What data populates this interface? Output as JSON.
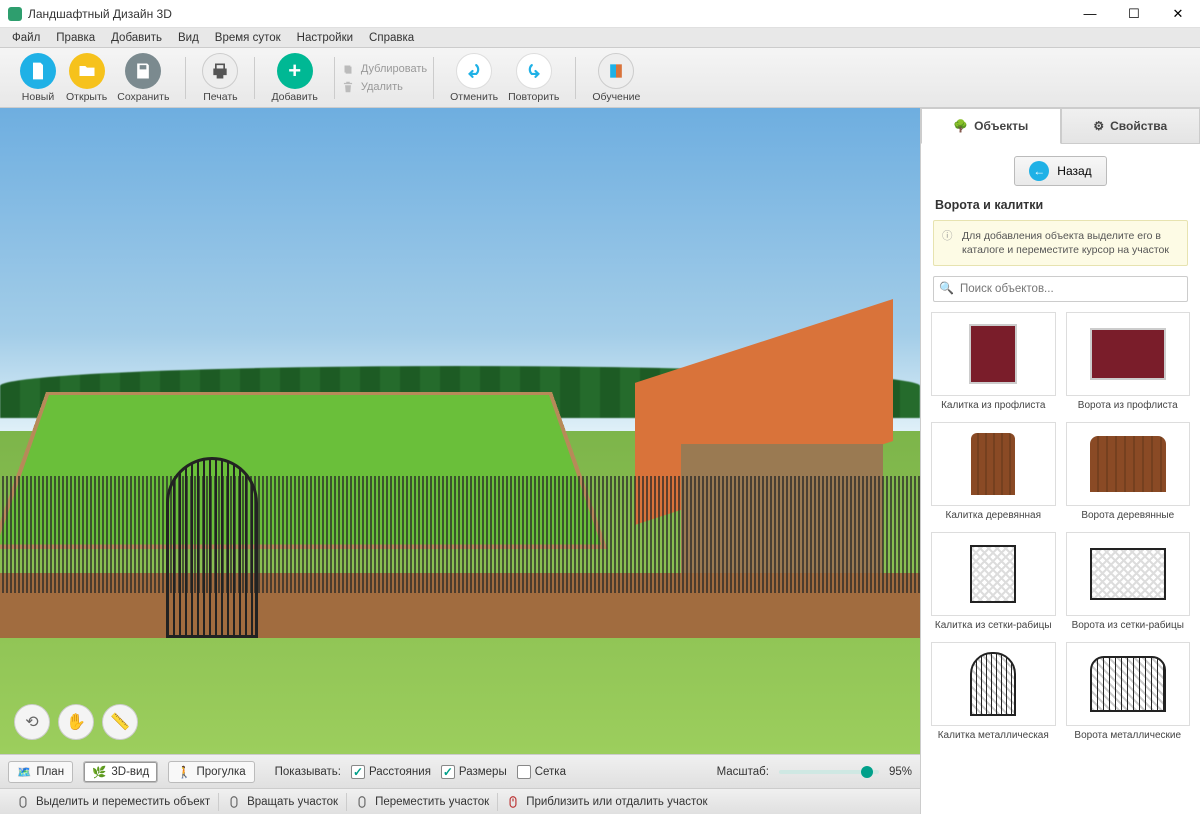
{
  "window": {
    "title": "Ландшафтный Дизайн 3D"
  },
  "menu": [
    "Файл",
    "Правка",
    "Добавить",
    "Вид",
    "Время суток",
    "Настройки",
    "Справка"
  ],
  "toolbar": {
    "new": "Новый",
    "open": "Открыть",
    "save": "Сохранить",
    "print": "Печать",
    "add": "Добавить",
    "duplicate": "Дублировать",
    "delete": "Удалить",
    "undo": "Отменить",
    "redo": "Повторить",
    "help": "Обучение"
  },
  "viewbar": {
    "plan": "План",
    "view3d": "3D-вид",
    "walk": "Прогулка",
    "show_label": "Показывать:",
    "distances": "Расстояния",
    "sizes": "Размеры",
    "grid": "Сетка",
    "zoom_label": "Масштаб:",
    "zoom_value": "95%",
    "zoom_percent": 95
  },
  "actionbar": {
    "select": "Выделить и переместить объект",
    "rotate": "Вращать участок",
    "move": "Переместить участок",
    "zoom": "Приблизить или отдалить участок"
  },
  "panel": {
    "tab_objects": "Объекты",
    "tab_properties": "Свойства",
    "back": "Назад",
    "section": "Ворота и калитки",
    "hint": "Для добавления объекта выделите его в каталоге и переместите курсор на участок",
    "search_placeholder": "Поиск объектов...",
    "items": [
      {
        "label": "Калитка из профлиста",
        "cls": "th-profl-gate"
      },
      {
        "label": "Ворота из профлиста",
        "cls": "th-profl-gates"
      },
      {
        "label": "Калитка деревянная",
        "cls": "th-wood-gate"
      },
      {
        "label": "Ворота деревянные",
        "cls": "th-wood-gates"
      },
      {
        "label": "Калитка из сетки-рабицы",
        "cls": "th-mesh-gate"
      },
      {
        "label": "Ворота из сетки-рабицы",
        "cls": "th-mesh-gates"
      },
      {
        "label": "Калитка металлическая",
        "cls": "th-metal-gate"
      },
      {
        "label": "Ворота металлические",
        "cls": "th-metal-gates"
      }
    ]
  }
}
